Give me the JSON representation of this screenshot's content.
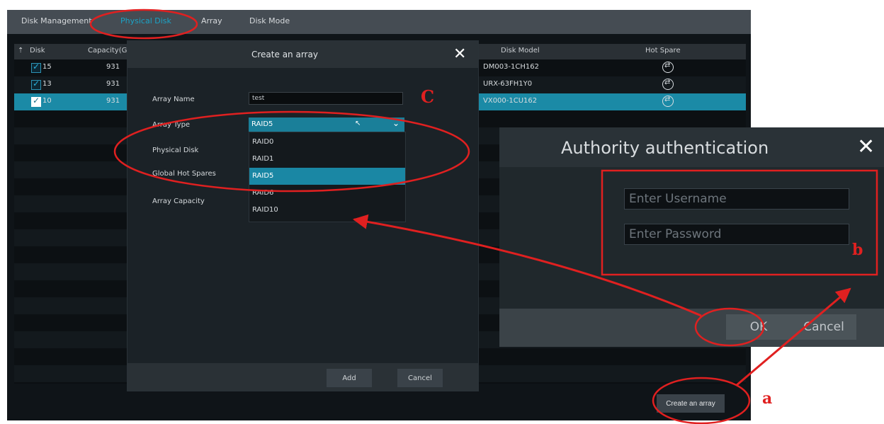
{
  "tabs": [
    "Disk Management",
    "Physical Disk",
    "Array",
    "Disk Mode"
  ],
  "table": {
    "headers": {
      "disk": "Disk",
      "capacity": "Capacity(GI",
      "model": "Disk Model",
      "hot_spare": "Hot Spare"
    },
    "rows": [
      {
        "disk": "15",
        "capacity": "931",
        "model": "DM003-1CH162"
      },
      {
        "disk": "13",
        "capacity": "931",
        "model": "URX-63FH1Y0"
      },
      {
        "disk": "10",
        "capacity": "931",
        "model": "VX000-1CU162"
      }
    ]
  },
  "create_button": "Create an array",
  "dialog": {
    "title": "Create an array",
    "labels": {
      "array_name": "Array Name",
      "array_type": "Array Type",
      "physical_disk": "Physical Disk",
      "global_hot_spares": "Global Hot Spares",
      "array_capacity": "Array Capacity"
    },
    "array_name_value": "test",
    "array_type_value": "RAID5",
    "options": [
      "RAID0",
      "RAID1",
      "RAID5",
      "RAID6",
      "RAID10"
    ],
    "highlighted_option": "RAID5",
    "add_label": "Add",
    "cancel_label": "Cancel"
  },
  "auth": {
    "title": "Authority authentication",
    "username_placeholder": "Enter Username",
    "password_placeholder": "Enter Password",
    "ok_label": "OK",
    "cancel_label": "Cancel"
  },
  "annotations": {
    "a": "a",
    "b": "b",
    "c": "C"
  },
  "colors": {
    "annotation": "#e02020",
    "accent": "#1b8aa6"
  }
}
